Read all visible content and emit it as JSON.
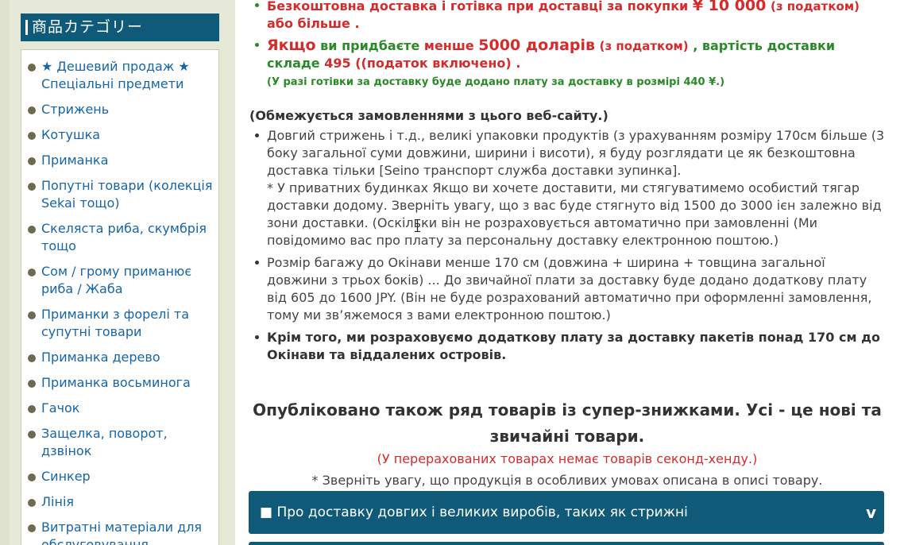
{
  "sidebar": {
    "header": "商品カテゴリー",
    "items": [
      "★ Дешевий продаж ★ Спеціальні предмети",
      "Стрижень",
      "Котушка",
      "Приманка",
      "Попутні товари (колекція Sekai тощо)",
      "Скеляста риба, скумбрія тощо",
      "Сом / грому приманює риба / Жаба",
      "Приманки з форелі та супутні товари",
      "Приманка дерево",
      "Приманка восьминога",
      "Гачок",
      "Защелка, поворот, дзвінок",
      "Синкер",
      "Лінія",
      "Витратні матеріали для обслуговування"
    ]
  },
  "main": {
    "b1": {
      "t1": "Безкоштовна доставка і готівка при доставці за покупки",
      "amount": "¥ 10 000",
      "t2": "(з податком)",
      "t3": "або більше ."
    },
    "b2": {
      "t1": "Якщо",
      "t2": "ви придбаєте",
      "t3": "менше",
      "amount": "5000 доларів",
      "t4": "(з податком)",
      "t5": ", вартість доставки складе",
      "t6": "495 ((податок включено)",
      "t7": "."
    },
    "b2_note": "(У разі готівки за доставку буде додано плату за доставку в розмірі 440 ¥.)",
    "restrict": "(Обмежується замовленнями з цього веб-сайту.)",
    "b3": "Довгий стрижень і т.д., великі упаковки продуктів (з урахуванням розміру 170см більше (3 боку загальної суми довжини, ширини і висоти), я буду розглядати це як безкоштовна доставка тільки [Seino транспорт служба доставки зупинка].",
    "b3_note": "* У приватних будинках Якщо ви хочете доставити, ми стягуватимемо особистий тягар доставки додому. Зверніть увагу, що з вас буде стягнуто від 1500 до 3000 ієн залежно від зони доставки. (Оскільки він не розраховується автоматично при замовленні (Ми повідомимо вас про плату за персональну доставку електронною поштою.)",
    "b4": "Розмір багажу до Окінави менше 170 см (довжина + ширина + товщина загальної довжини з трьох боків) ... До звичайної плати за доставку буде додано додаткову плату від 605 до 1600 JPY. (Він не буде розрахований автоматично при оформленні замовлення, тому ми зв’яжемося з вами електронною поштою.)",
    "b5": "Крім того, ми розраховуємо додаткову плату за доставку пакетів понад 170 см до Окінави та віддалених островів.",
    "headline": "Опубліковано також ряд товарів із супер-знижками. Усі - це нові та звичайні товари.",
    "red_note": "(У перерахованих товарах немає товарів секонд-хенду.)",
    "attention": "* Зверніть увагу, що продукція в особливих умовах описана в описі товару.",
    "accordion": {
      "label": "■ Про доставку довгих і великих виробів, таких як стрижні",
      "chevron": "v"
    }
  },
  "colors": {
    "accent": "#0e5a78",
    "link": "#1565a8",
    "red": "#d52b2b",
    "green": "#2a8a2a"
  }
}
